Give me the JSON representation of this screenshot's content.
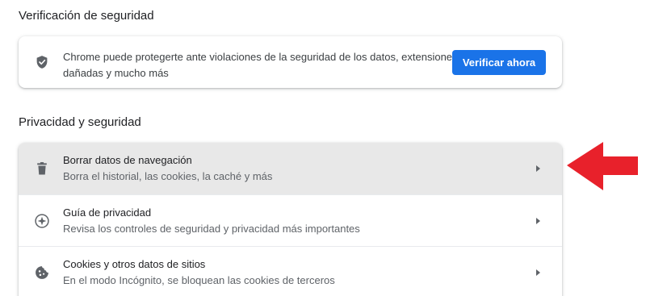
{
  "safety_check": {
    "heading": "Verificación de seguridad",
    "icon": "shield-check-icon",
    "description": "Chrome puede protegerte ante violaciones de la seguridad de los datos, extensiones dañadas y mucho más",
    "button_label": "Verificar ahora"
  },
  "privacy": {
    "heading": "Privacidad y seguridad",
    "items": [
      {
        "icon": "trash-icon",
        "title": "Borrar datos de navegación",
        "subtitle": "Borra el historial, las cookies, la caché y más",
        "highlighted": true
      },
      {
        "icon": "compass-icon",
        "title": "Guía de privacidad",
        "subtitle": "Revisa los controles de seguridad y privacidad más importantes",
        "highlighted": false
      },
      {
        "icon": "cookie-icon",
        "title": "Cookies y otros datos de sitios",
        "subtitle": "En el modo Incógnito, se bloquean las cookies de terceros",
        "highlighted": false
      }
    ]
  },
  "colors": {
    "accent": "#1a73e8",
    "highlight_row": "#e8e8e8",
    "annotation_arrow": "#e8212b"
  }
}
